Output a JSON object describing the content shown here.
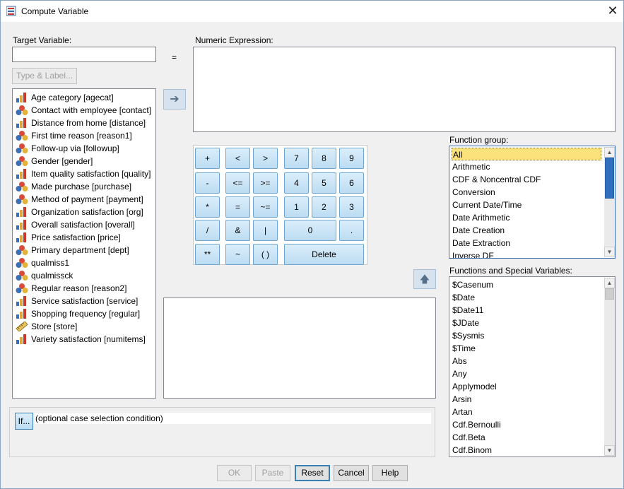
{
  "window": {
    "title": "Compute Variable",
    "close_glyph": "✕"
  },
  "target_variable": {
    "label": "Target Variable:",
    "value": ""
  },
  "equals_sign": "=",
  "type_label_button": "Type & Label...",
  "numeric_expression": {
    "label": "Numeric Expression:",
    "value": ""
  },
  "move_arrow": "➔",
  "up_arrow": "🡅",
  "variables": [
    {
      "label": "Age category [agecat]",
      "icon": "ordinal-bar-icon"
    },
    {
      "label": "Contact with employee [contact]",
      "icon": "nominal-circles-icon"
    },
    {
      "label": "Distance from home [distance]",
      "icon": "ordinal-bar-icon"
    },
    {
      "label": "First time reason [reason1]",
      "icon": "nominal-circles-icon"
    },
    {
      "label": "Follow-up via [followup]",
      "icon": "nominal-circles-icon"
    },
    {
      "label": "Gender [gender]",
      "icon": "nominal-circles-icon"
    },
    {
      "label": "Item quality satisfaction [quality]",
      "icon": "ordinal-bar-icon"
    },
    {
      "label": "Made purchase [purchase]",
      "icon": "nominal-circles-icon"
    },
    {
      "label": "Method of payment [payment]",
      "icon": "nominal-circles-icon"
    },
    {
      "label": "Organization satisfaction [org]",
      "icon": "ordinal-bar-icon"
    },
    {
      "label": "Overall satisfaction [overall]",
      "icon": "ordinal-bar-icon"
    },
    {
      "label": "Price satisfaction [price]",
      "icon": "ordinal-bar-icon"
    },
    {
      "label": "Primary department [dept]",
      "icon": "nominal-circles-icon"
    },
    {
      "label": "qualmiss1",
      "icon": "nominal-circles-icon"
    },
    {
      "label": "qualmissck",
      "icon": "nominal-circles-icon"
    },
    {
      "label": "Regular reason [reason2]",
      "icon": "nominal-circles-icon"
    },
    {
      "label": "Service satisfaction [service]",
      "icon": "ordinal-bar-icon"
    },
    {
      "label": "Shopping frequency [regular]",
      "icon": "ordinal-bar-icon"
    },
    {
      "label": "Store [store]",
      "icon": "scale-ruler-icon"
    },
    {
      "label": "Variety satisfaction [numitems]",
      "icon": "ordinal-bar-icon"
    }
  ],
  "keypad": {
    "plus": "+",
    "lt": "<",
    "gt": ">",
    "k7": "7",
    "k8": "8",
    "k9": "9",
    "minus": "-",
    "le": "<=",
    "ge": ">=",
    "k4": "4",
    "k5": "5",
    "k6": "6",
    "mult": "*",
    "eq": "=",
    "ne": "~=",
    "k1": "1",
    "k2": "2",
    "k3": "3",
    "div": "/",
    "and": "&",
    "or": "|",
    "k0": "0",
    "dot": ".",
    "pow": "**",
    "not": "~",
    "paren": "( )",
    "delete": "Delete"
  },
  "function_group": {
    "label": "Function group:",
    "items": [
      "All",
      "Arithmetic",
      "CDF & Noncentral CDF",
      "Conversion",
      "Current Date/Time",
      "Date Arithmetic",
      "Date Creation",
      "Date Extraction",
      "Inverse DF"
    ],
    "selected": "All"
  },
  "functions": {
    "label": "Functions and Special Variables:",
    "items": [
      "$Casenum",
      "$Date",
      "$Date11",
      "$JDate",
      "$Sysmis",
      "$Time",
      "Abs",
      "Any",
      "Applymodel",
      "Arsin",
      "Artan",
      "Cdf.Bernoulli",
      "Cdf.Beta",
      "Cdf.Binom"
    ]
  },
  "if_button": "If...",
  "if_condition": "(optional case selection condition)",
  "buttons": {
    "ok": "OK",
    "paste": "Paste",
    "reset": "Reset",
    "cancel": "Cancel",
    "help": "Help"
  },
  "colors": {
    "selection": "#fbe27b",
    "keypad_button": "#cde6f7",
    "frame": "#8aa6c8"
  }
}
